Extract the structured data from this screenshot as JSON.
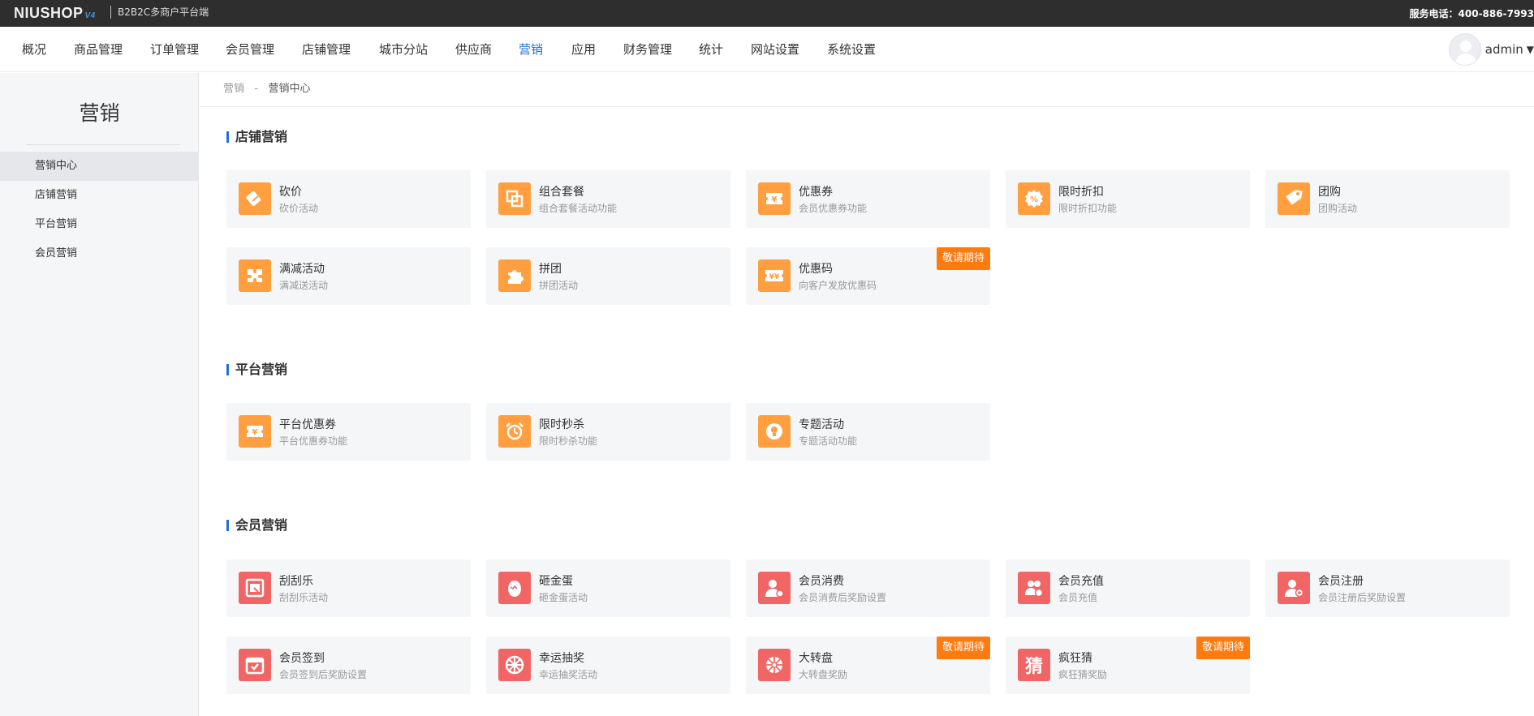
{
  "colors": {
    "accent": "#1e6fe0",
    "orange_icon": "#ff9f40",
    "red_icon": "#f26565",
    "badge": "#ff7a0f",
    "topbar": "#2e2e2e"
  },
  "topbar": {
    "logo": "NIUSHOP",
    "logo_version": "V4",
    "platform": "B2B2C多商户平台端",
    "phone": "服务电话：400-886-7993"
  },
  "nav": {
    "items": [
      "概况",
      "商品管理",
      "订单管理",
      "会员管理",
      "店铺管理",
      "城市分站",
      "供应商",
      "营销",
      "应用",
      "财务管理",
      "统计",
      "网站设置",
      "系统设置"
    ],
    "active": "营销",
    "user": "admin"
  },
  "sidebar": {
    "title": "营销",
    "items": [
      "营销中心",
      "店铺营销",
      "平台营销",
      "会员营销"
    ],
    "active": "营销中心"
  },
  "breadcrumb": {
    "parent": "营销",
    "sep": "-",
    "current": "营销中心"
  },
  "sections": [
    {
      "title": "店铺营销",
      "cards": [
        {
          "title": "砍价",
          "desc": "砍价活动",
          "icon": "bargain-icon",
          "color": "orange"
        },
        {
          "title": "组合套餐",
          "desc": "组合套餐活动功能",
          "icon": "combo-icon",
          "color": "orange"
        },
        {
          "title": "优惠券",
          "desc": "会员优惠券功能",
          "icon": "coupon-icon",
          "color": "orange"
        },
        {
          "title": "限时折扣",
          "desc": "限时折扣功能",
          "icon": "discount-icon",
          "color": "orange"
        },
        {
          "title": "团购",
          "desc": "团购活动",
          "icon": "groupbuy-tag-icon",
          "color": "orange"
        },
        {
          "title": "满减活动",
          "desc": "满减送活动",
          "icon": "full-reduction-icon",
          "color": "orange"
        },
        {
          "title": "拼团",
          "desc": "拼团活动",
          "icon": "puzzle-icon",
          "color": "orange"
        },
        {
          "title": "优惠码",
          "desc": "向客户发放优惠码",
          "icon": "coupon-code-icon",
          "color": "orange",
          "badge": "敬请期待"
        }
      ]
    },
    {
      "title": "平台营销",
      "cards": [
        {
          "title": "平台优惠券",
          "desc": "平台优惠券功能",
          "icon": "platform-coupon-icon",
          "color": "orange"
        },
        {
          "title": "限时秒杀",
          "desc": "限时秒杀功能",
          "icon": "alarm-clock-icon",
          "color": "orange"
        },
        {
          "title": "专题活动",
          "desc": "专题活动功能",
          "icon": "bulb-icon",
          "color": "orange"
        }
      ]
    },
    {
      "title": "会员营销",
      "cards": [
        {
          "title": "刮刮乐",
          "desc": "刮刮乐活动",
          "icon": "scratch-card-icon",
          "color": "red"
        },
        {
          "title": "砸金蛋",
          "desc": "砸金蛋活动",
          "icon": "egg-icon",
          "color": "red"
        },
        {
          "title": "会员消费",
          "desc": "会员消费后奖励设置",
          "icon": "member-consume-icon",
          "color": "red"
        },
        {
          "title": "会员充值",
          "desc": "会员充值",
          "icon": "member-recharge-icon",
          "color": "red"
        },
        {
          "title": "会员注册",
          "desc": "会员注册后奖励设置",
          "icon": "member-register-icon",
          "color": "red"
        },
        {
          "title": "会员签到",
          "desc": "会员签到后奖励设置",
          "icon": "calendar-checkin-icon",
          "color": "red"
        },
        {
          "title": "幸运抽奖",
          "desc": "幸运抽奖活动",
          "icon": "lucky-wheel-icon",
          "color": "red"
        },
        {
          "title": "大转盘",
          "desc": "大转盘奖励",
          "icon": "wheel-icon",
          "color": "red",
          "badge": "敬请期待"
        },
        {
          "title": "疯狂猜",
          "desc": "疯狂猜奖励",
          "icon": "guess-icon",
          "color": "red",
          "badge": "敬请期待",
          "glyph": "猜"
        }
      ]
    }
  ]
}
